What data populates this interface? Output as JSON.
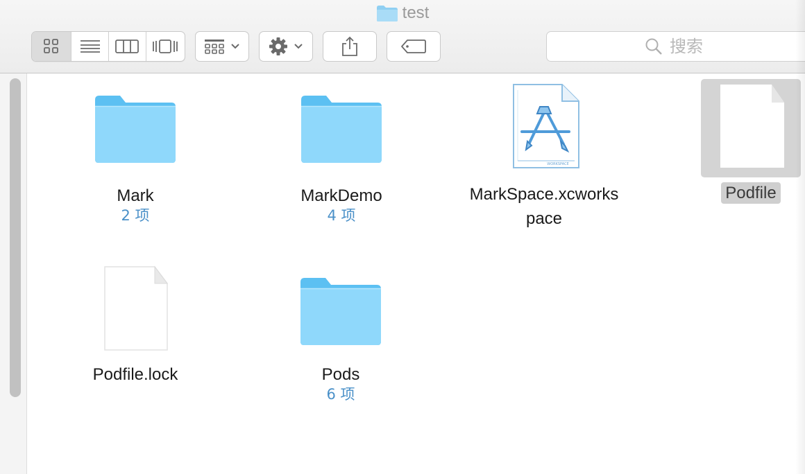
{
  "window": {
    "title": "test",
    "title_icon": "folder-icon"
  },
  "toolbar": {
    "view_modes": [
      {
        "name": "icon-view",
        "icon": "grid-icon",
        "active": true
      },
      {
        "name": "list-view",
        "icon": "list-icon",
        "active": false
      },
      {
        "name": "column-view",
        "icon": "columns-icon",
        "active": false
      },
      {
        "name": "cover-flow-view",
        "icon": "cover-flow-icon",
        "active": false
      }
    ],
    "arrange_icon": "arrange-icon",
    "action_icon": "gear-icon",
    "share_icon": "share-icon",
    "tags_icon": "tag-icon"
  },
  "search": {
    "placeholder": "搜索",
    "icon": "search-icon"
  },
  "items": [
    {
      "name": "Mark",
      "count": "2 项",
      "type": "folder"
    },
    {
      "name": "MarkDemo",
      "count": "4 项",
      "type": "folder"
    },
    {
      "name_line1": "MarkSpace.xcworks",
      "name_line2": "pace",
      "type": "workspace",
      "badge": "WORKSPACE"
    },
    {
      "name": "Podfile",
      "type": "file",
      "selected": true
    },
    {
      "name": "Podfile.lock",
      "type": "file"
    },
    {
      "name": "Pods",
      "count": "6 项",
      "type": "folder"
    }
  ],
  "colors": {
    "folder_light": "#8fd8fb",
    "folder_dark": "#5cc0f2",
    "count_text": "#4a90c8",
    "selection": "#d4d4d4"
  }
}
